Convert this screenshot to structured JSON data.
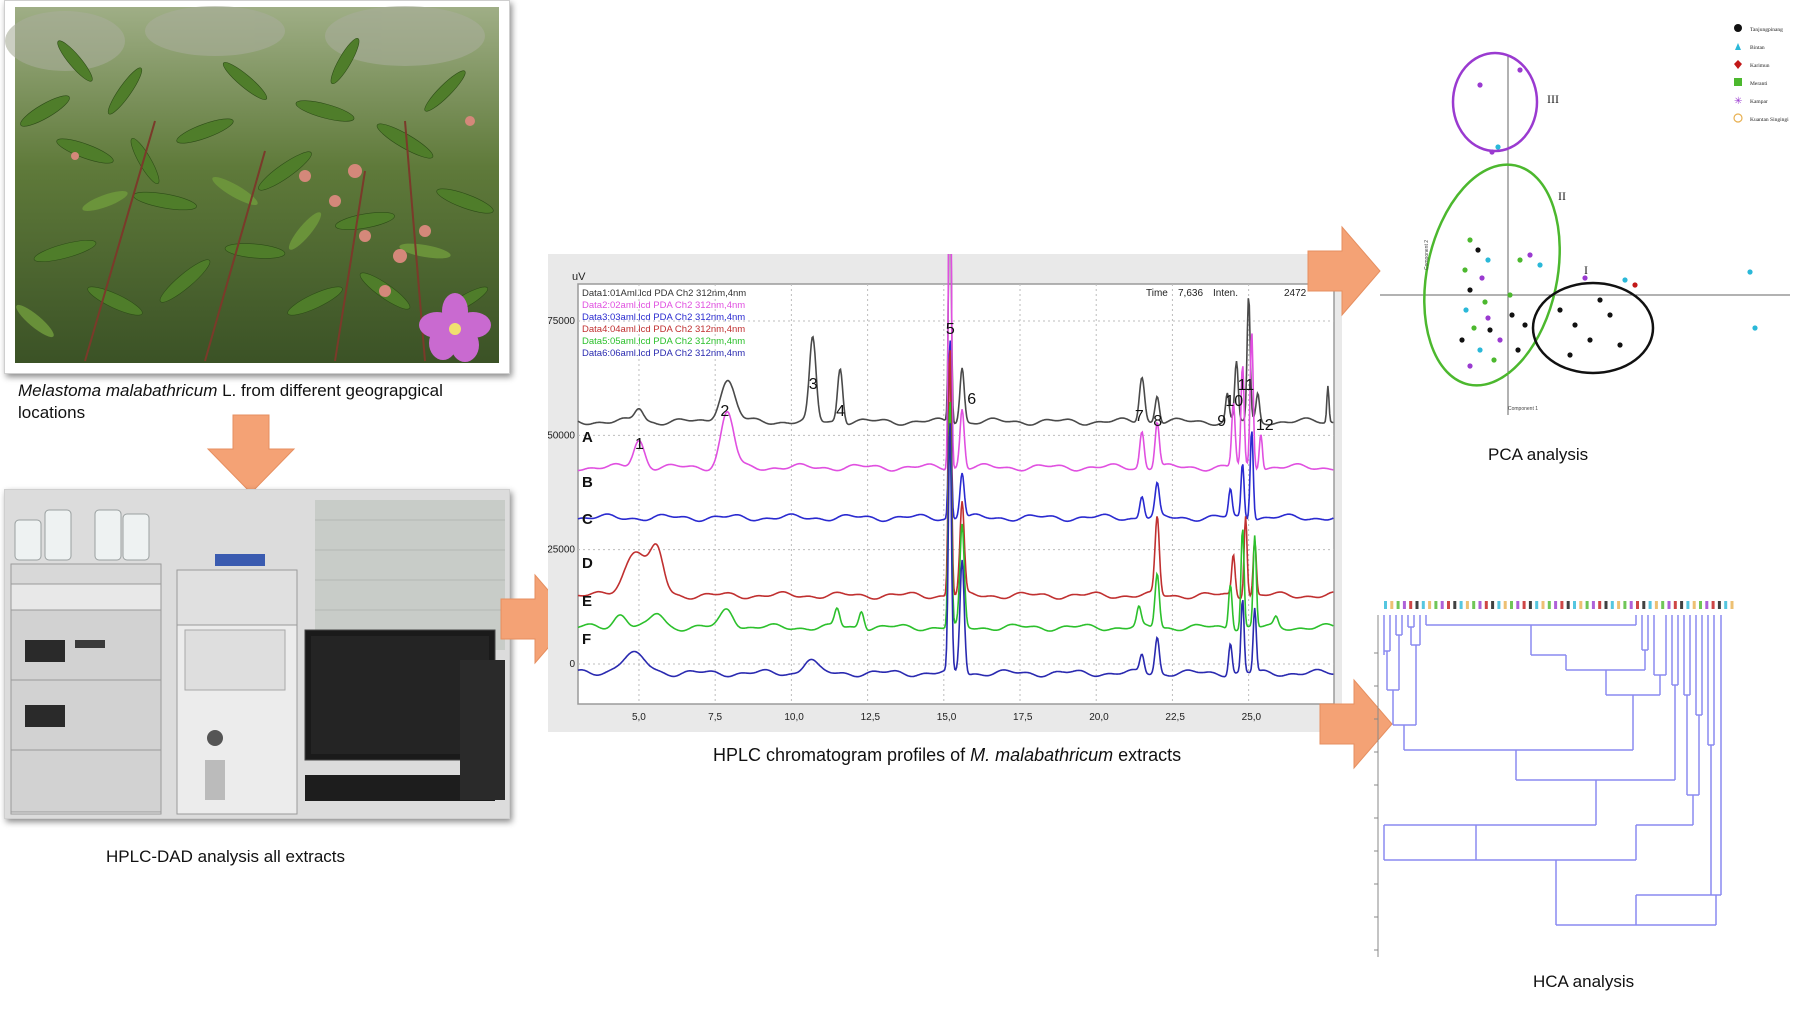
{
  "captions": {
    "plant": {
      "italic_part": "Melastoma malabathricum",
      "rest_line1": " L. from different geograpgical",
      "line2": "locations"
    },
    "hplc_dad": "HPLC-DAD analysis all extracts",
    "chromatogram": {
      "before": "HPLC chromatogram profiles of ",
      "italic": "M. malabathricum",
      "after": " extracts"
    },
    "pca": "PCA analysis",
    "hca": "HCA analysis"
  },
  "colors": {
    "arrow_fill": "#f4a275",
    "trace_A": "#4a4a4a",
    "trace_B": "#e050e0",
    "trace_C": "#2a2ad0",
    "trace_D": "#c03030",
    "trace_E": "#2cc02c",
    "trace_F": "#2a2ab0",
    "pca_group_I": "#111111",
    "pca_group_II": "#4cb82e",
    "pca_group_III": "#9a3ad0",
    "dendrogram": "#8a8af0"
  },
  "chart_data": {
    "type": "line",
    "y_unit_label": "uV",
    "header_right": [
      "Time",
      "7,636",
      "Inten.",
      "2472"
    ],
    "legend": [
      "Data1:01Aml.lcd PDA Ch2 312nm,4nm",
      "Data2:02aml.lcd PDA Ch2 312nm,4nm",
      "Data3:03aml.lcd PDA Ch2 312nm,4nm",
      "Data4:04aml.lcd PDA Ch2 312nm,4nm",
      "Data5:05aml.lcd PDA Ch2 312nm,4nm",
      "Data6:06aml.lcd PDA Ch2 312nm,4nm"
    ],
    "x_ticks": [
      "5,0",
      "7,5",
      "10,0",
      "12,5",
      "15,0",
      "17,5",
      "20,0",
      "22,5",
      "25,0"
    ],
    "y_ticks": [
      "0",
      "25000",
      "50000",
      "75000"
    ],
    "trace_letters": [
      "A",
      "B",
      "C",
      "D",
      "E",
      "F"
    ],
    "peak_numbers": [
      "1",
      "2",
      "3",
      "4",
      "5",
      "6",
      "7",
      "8",
      "9",
      "10",
      "11",
      "12"
    ]
  },
  "pca": {
    "legend": [
      "Tanjungpinang",
      "Bintan",
      "Karimun",
      "Meranti",
      "Kampar",
      "Kuantan Singingi"
    ],
    "group_labels": [
      "I",
      "II",
      "III"
    ],
    "x_axis_title": "Component 1",
    "y_axis_title": "Component 2"
  }
}
